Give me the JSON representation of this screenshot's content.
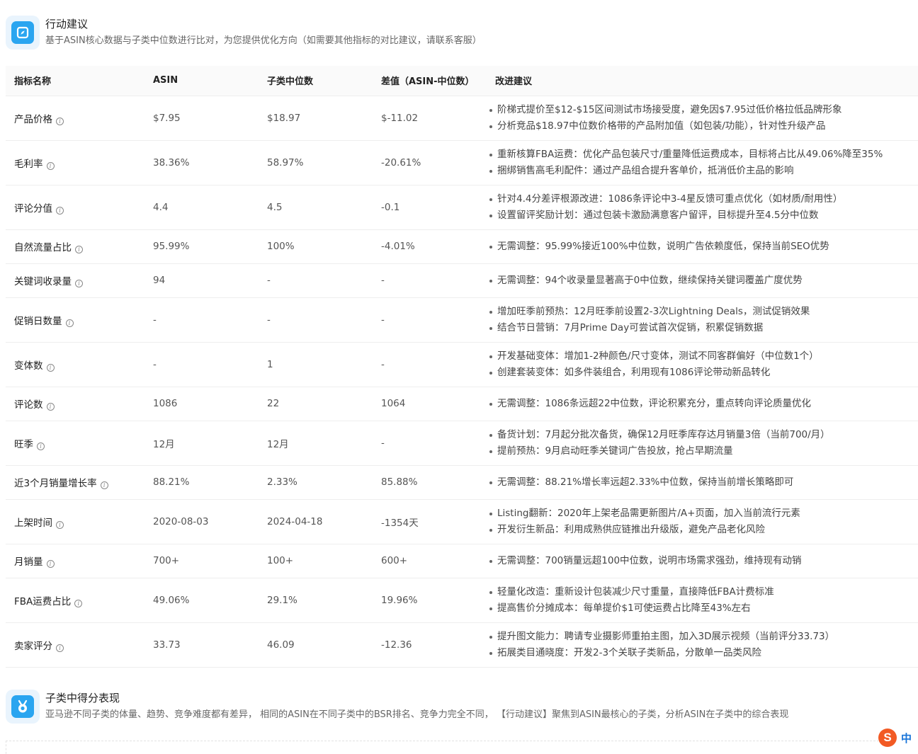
{
  "actions_header": {
    "title": "行动建议",
    "description": "基于ASIN核心数据与子类中位数进行比对，为您提供优化方向（如需要其他指标的对比建议，请联系客服）",
    "icon": "compass-icon"
  },
  "table": {
    "headers": {
      "metric": "指标名称",
      "asin": "ASIN",
      "median": "子类中位数",
      "diff": "差值（ASIN-中位数）",
      "suggestion": "改进建议"
    },
    "rows": [
      {
        "metric": "产品价格",
        "asin": "$7.95",
        "median": "$18.97",
        "diff": "$-11.02",
        "suggestions": [
          "阶梯式提价至$12-$15区间测试市场接受度，避免因$7.95过低价格拉低品牌形象",
          "分析竞品$18.97中位数价格带的产品附加值（如包装/功能），针对性升级产品"
        ]
      },
      {
        "metric": "毛利率",
        "asin": "38.36%",
        "median": "58.97%",
        "diff": "-20.61%",
        "suggestions": [
          "重新核算FBA运费：优化产品包装尺寸/重量降低运费成本，目标将占比从49.06%降至35%",
          "捆绑销售高毛利配件：通过产品组合提升客单价，抵消低价主品的影响"
        ]
      },
      {
        "metric": "评论分值",
        "asin": "4.4",
        "median": "4.5",
        "diff": "-0.1",
        "suggestions": [
          "针对4.4分差评根源改进：1086条评论中3-4星反馈可重点优化（如材质/耐用性）",
          "设置留评奖励计划：通过包装卡激励满意客户留评，目标提升至4.5分中位数"
        ]
      },
      {
        "metric": "自然流量占比",
        "asin": "95.99%",
        "median": "100%",
        "diff": "-4.01%",
        "suggestions": [
          "无需调整：95.99%接近100%中位数，说明广告依赖度低，保持当前SEO优势"
        ]
      },
      {
        "metric": "关键词收录量",
        "asin": "94",
        "median": "-",
        "diff": "-",
        "suggestions": [
          "无需调整：94个收录量显著高于0中位数，继续保持关键词覆盖广度优势"
        ]
      },
      {
        "metric": "促销日数量",
        "asin": "-",
        "median": "-",
        "diff": "-",
        "suggestions": [
          "增加旺季前预热：12月旺季前设置2-3次Lightning Deals，测试促销效果",
          "结合节日营销：7月Prime Day可尝试首次促销，积累促销数据"
        ]
      },
      {
        "metric": "变体数",
        "asin": "-",
        "median": "1",
        "diff": "-",
        "suggestions": [
          "开发基础变体：增加1-2种颜色/尺寸变体，测试不同客群偏好（中位数1个）",
          "创建套装变体：如多件装组合，利用现有1086评论带动新品转化"
        ]
      },
      {
        "metric": "评论数",
        "asin": "1086",
        "median": "22",
        "diff": "1064",
        "suggestions": [
          "无需调整：1086条远超22中位数，评论积累充分，重点转向评论质量优化"
        ]
      },
      {
        "metric": "旺季",
        "asin": "12月",
        "median": "12月",
        "diff": "-",
        "suggestions": [
          "备货计划：7月起分批次备货，确保12月旺季库存达月销量3倍（当前700/月）",
          "提前预热：9月启动旺季关键词广告投放，抢占早期流量"
        ]
      },
      {
        "metric": "近3个月销量增长率",
        "asin": "88.21%",
        "median": "2.33%",
        "diff": "85.88%",
        "suggestions": [
          "无需调整：88.21%增长率远超2.33%中位数，保持当前增长策略即可"
        ]
      },
      {
        "metric": "上架时间",
        "asin": "2020-08-03",
        "median": "2024-04-18",
        "diff": "-1354天",
        "suggestions": [
          "Listing翻新：2020年上架老品需更新图片/A+页面，加入当前流行元素",
          "开发衍生新品：利用成熟供应链推出升级版，避免产品老化风险"
        ]
      },
      {
        "metric": "月销量",
        "asin": "700+",
        "median": "100+",
        "diff": "600+",
        "suggestions": [
          "无需调整：700销量远超100中位数，说明市场需求强劲，维持现有动销"
        ]
      },
      {
        "metric": "FBA运费占比",
        "asin": "49.06%",
        "median": "29.1%",
        "diff": "19.96%",
        "suggestions": [
          "轻量化改造：重新设计包装减少尺寸重量，直接降低FBA计费标准",
          "提高售价分摊成本：每单提价$1可使运费占比降至43%左右"
        ]
      },
      {
        "metric": "卖家评分",
        "asin": "33.73",
        "median": "46.09",
        "diff": "-12.36",
        "suggestions": [
          "提升图文能力：聘请专业摄影师重拍主图，加入3D展示视频（当前评分33.73）",
          "拓展类目通晓度：开发2-3个关联子类新品，分散单一品类风险"
        ]
      }
    ]
  },
  "subcategory_header": {
    "title": "子类中得分表现",
    "description": "亚马逊不同子类的体量、趋势、竞争难度都有差异， 相同的ASIN在不同子类中的BSR排名、竞争力完全不同， 【行动建议】聚焦到ASIN最核心的子类，分析ASIN在子类中的综合表现",
    "icon": "medal-icon"
  },
  "ime": {
    "logo": "S",
    "lang": "中"
  },
  "colors": {
    "accent": "#2aa5f0",
    "icon_bg": "#e9f4fd",
    "ime_orange": "#f25a24",
    "ime_blue": "#1673d8"
  }
}
